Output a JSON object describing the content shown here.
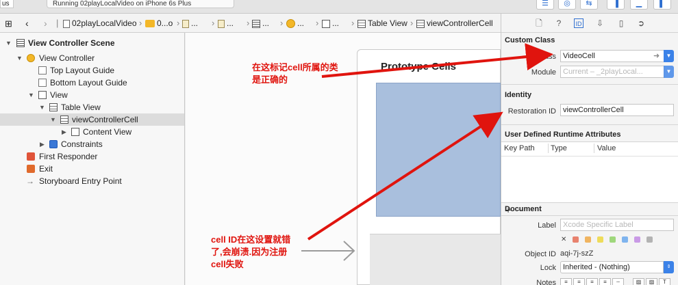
{
  "toolbar": {
    "scheme_text": "us",
    "status_text": "Running 02playLocalVideo on iPhone 6s Plus"
  },
  "jumpbar": {
    "crumbs": [
      "02playLocalVideo",
      "0...o",
      "...",
      "...",
      "...",
      "...",
      "...",
      "Table View",
      "viewControllerCell"
    ]
  },
  "outline": {
    "rows": [
      {
        "label": "View Controller Scene"
      },
      {
        "label": "View Controller"
      },
      {
        "label": "Top Layout Guide"
      },
      {
        "label": "Bottom Layout Guide"
      },
      {
        "label": "View"
      },
      {
        "label": "Table View"
      },
      {
        "label": "viewControllerCell"
      },
      {
        "label": "Content View"
      },
      {
        "label": "Constraints"
      },
      {
        "label": "First Responder"
      },
      {
        "label": "Exit"
      },
      {
        "label": "Storyboard Entry Point"
      }
    ]
  },
  "canvas": {
    "prototype_title": "Prototype Cells"
  },
  "annotations": {
    "note_class": "在这标记cell所属的类\n是正确的",
    "note_id": "cell ID在这设置就错\n了,会崩溃.因为注册\ncell失败",
    "color": "#e0140e"
  },
  "inspector": {
    "custom_class": {
      "header": "Custom Class",
      "class_label": "Class",
      "class_value": "VideoCell",
      "module_label": "Module",
      "module_placeholder": "Current – _2playLocal..."
    },
    "identity": {
      "header": "Identity",
      "restoration_label": "Restoration ID",
      "restoration_value": "viewControllerCell"
    },
    "udra": {
      "header": "User Defined Runtime Attributes",
      "col_key": "Key Path",
      "col_type": "Type",
      "col_value": "Value",
      "add": "+",
      "remove": "−"
    },
    "document": {
      "header": "Document",
      "label_label": "Label",
      "label_placeholder": "Xcode Specific Label",
      "object_id_label": "Object ID",
      "object_id_value": "aqi-7j-szZ",
      "lock_label": "Lock",
      "lock_value": "Inherited - (Nothing)",
      "notes_label": "Notes",
      "clear_glyph": "✕",
      "swatch_colors": [
        "#e8826e",
        "#f0b460",
        "#eedc5a",
        "#9fd77c",
        "#7fb4ee",
        "#c99ae6",
        "#b3b3b3"
      ]
    }
  },
  "accent": "#2f6fd0",
  "selected_bg": "#dcdcdc"
}
